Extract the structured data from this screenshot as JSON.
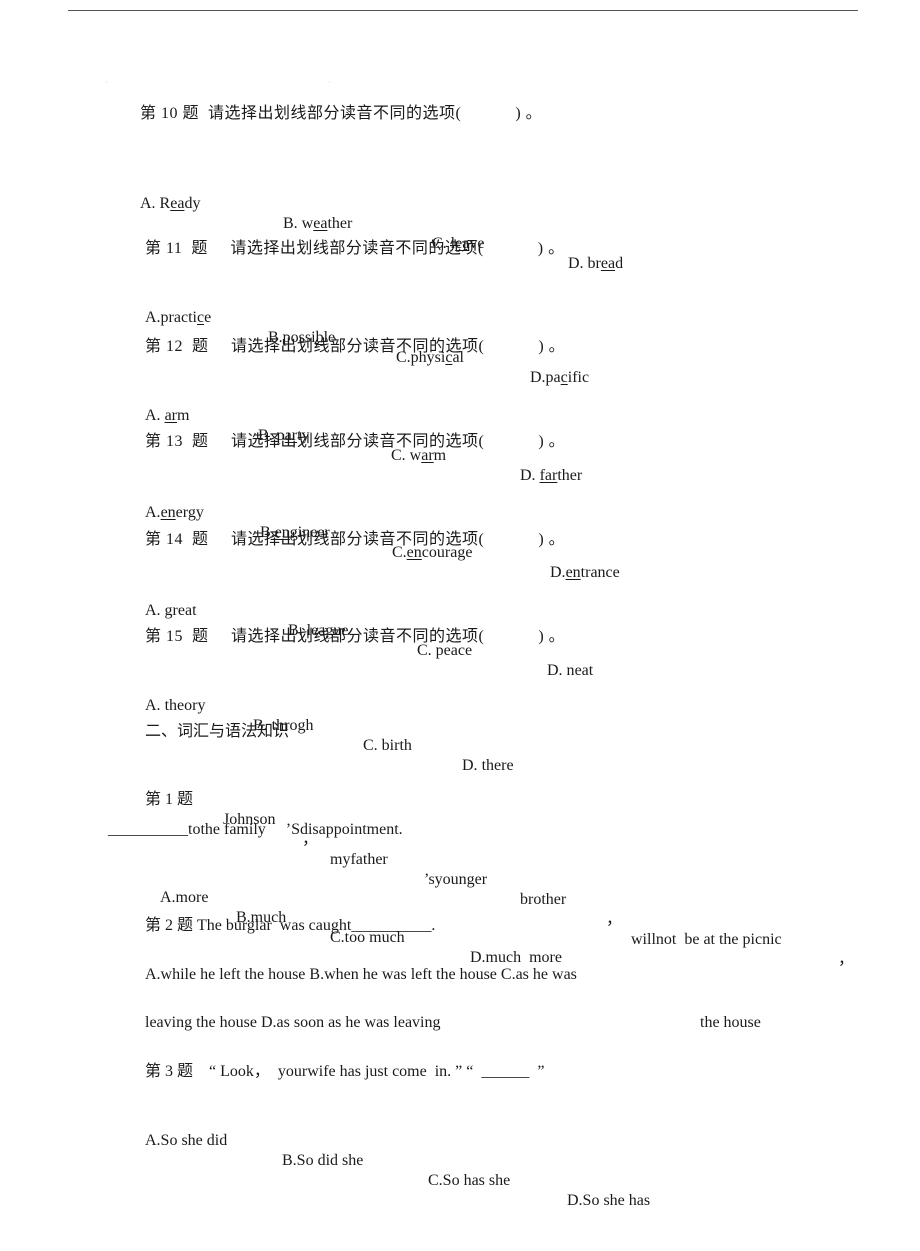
{
  "document": {
    "section_one_questions": [
      {
        "title": "第 10 题  请选择出划线部分读音不同的选项(            ) 。",
        "options": [
          {
            "prefix": "A. R",
            "underlined": "ea",
            "suffix": "dy"
          },
          {
            "prefix": "B. w",
            "underlined": "ea",
            "suffix": "ther"
          },
          {
            "prefix": "C. l",
            "underlined": "ea",
            "suffix": "ve"
          },
          {
            "prefix": "D. br",
            "underlined": "ea",
            "suffix": "d"
          }
        ]
      },
      {
        "title": "第 11  题     请选择出划线部分读音不同的选项(            ) 。",
        "options": [
          {
            "prefix": "A.practi",
            "underlined": "c",
            "suffix": "e"
          },
          {
            "prefix": "B.possi",
            "underlined": "b",
            "suffix": "le"
          },
          {
            "prefix": "C.physi",
            "underlined": "c",
            "suffix": "al"
          },
          {
            "prefix": "D.pa",
            "underlined": "c",
            "suffix": "ific"
          }
        ]
      },
      {
        "title": "第 12  题     请选择出划线部分读音不同的选项(            ) 。",
        "options": [
          {
            "prefix": "A. ",
            "underlined": "ar",
            "suffix": "m"
          },
          {
            "prefix": "B. p",
            "underlined": "ar",
            "suffix": "ty"
          },
          {
            "prefix": "C. w",
            "underlined": "ar",
            "suffix": "m"
          },
          {
            "prefix": "D. ",
            "underlined": "far",
            "suffix": "ther"
          }
        ]
      },
      {
        "title": "第 13  题     请选择出划线部分读音不同的选项(            ) 。",
        "options": [
          {
            "prefix": "A.",
            "underlined": "en",
            "suffix": "ergy"
          },
          {
            "prefix": "B.",
            "underlined": "en",
            "suffix": "gineer"
          },
          {
            "prefix": "C.",
            "underlined": "en",
            "suffix": "courage"
          },
          {
            "prefix": "D.",
            "underlined": "en",
            "suffix": "trance"
          }
        ]
      },
      {
        "title": "第 14  题     请选择出划线部分读音不同的选项(            ) 。",
        "options": [
          {
            "prefix": "A. gr",
            "underlined": "ea",
            "suffix": "t"
          },
          {
            "prefix": "B. l",
            "underlined": "ea",
            "suffix": "gue"
          },
          {
            "prefix": "C. p",
            "underlined": "ea",
            "suffix": "ce"
          },
          {
            "prefix": "D. n",
            "underlined": "ea",
            "suffix": "t"
          }
        ]
      },
      {
        "title": "第 15  题     请选择出划线部分读音不同的选项(            ) 。",
        "options": [
          {
            "prefix": "A. ",
            "underlined": "th",
            "suffix": "eory"
          },
          {
            "prefix": "B. ",
            "underlined": "th",
            "suffix": "rogh"
          },
          {
            "prefix": "C. bir",
            "underlined": "th",
            "suffix": ""
          },
          {
            "prefix": "D. ",
            "underlined": "th",
            "suffix": "ere"
          }
        ]
      }
    ],
    "section_two_heading": "二、词汇与语法知识",
    "q1": {
      "line1_parts": [
        "第 1 题",
        "Johnson",
        "，",
        "myfather",
        "’syounger",
        "brother",
        "，",
        "willnot  be at the picnic",
        "，"
      ],
      "line2": "__________tothe family     ’Sdisappointment.",
      "options": [
        "A.more",
        "B.much",
        "C.too much",
        "D.much  more"
      ]
    },
    "q2": {
      "stem": "第 2 题 The burglar  was caught__________.",
      "options_line1": "A.while he left the house B.when he was left the house C.as he was",
      "options_line2_left": "leaving the house D.as soon as he was leaving",
      "options_line2_right": "the house"
    },
    "q3": {
      "stem": "第 3 题    “ Look，  yourwife has just come  in. ” “  ______  ”",
      "options": [
        "A.So she did",
        "B.So did she",
        "C.So has she",
        "D.So she has"
      ]
    }
  }
}
